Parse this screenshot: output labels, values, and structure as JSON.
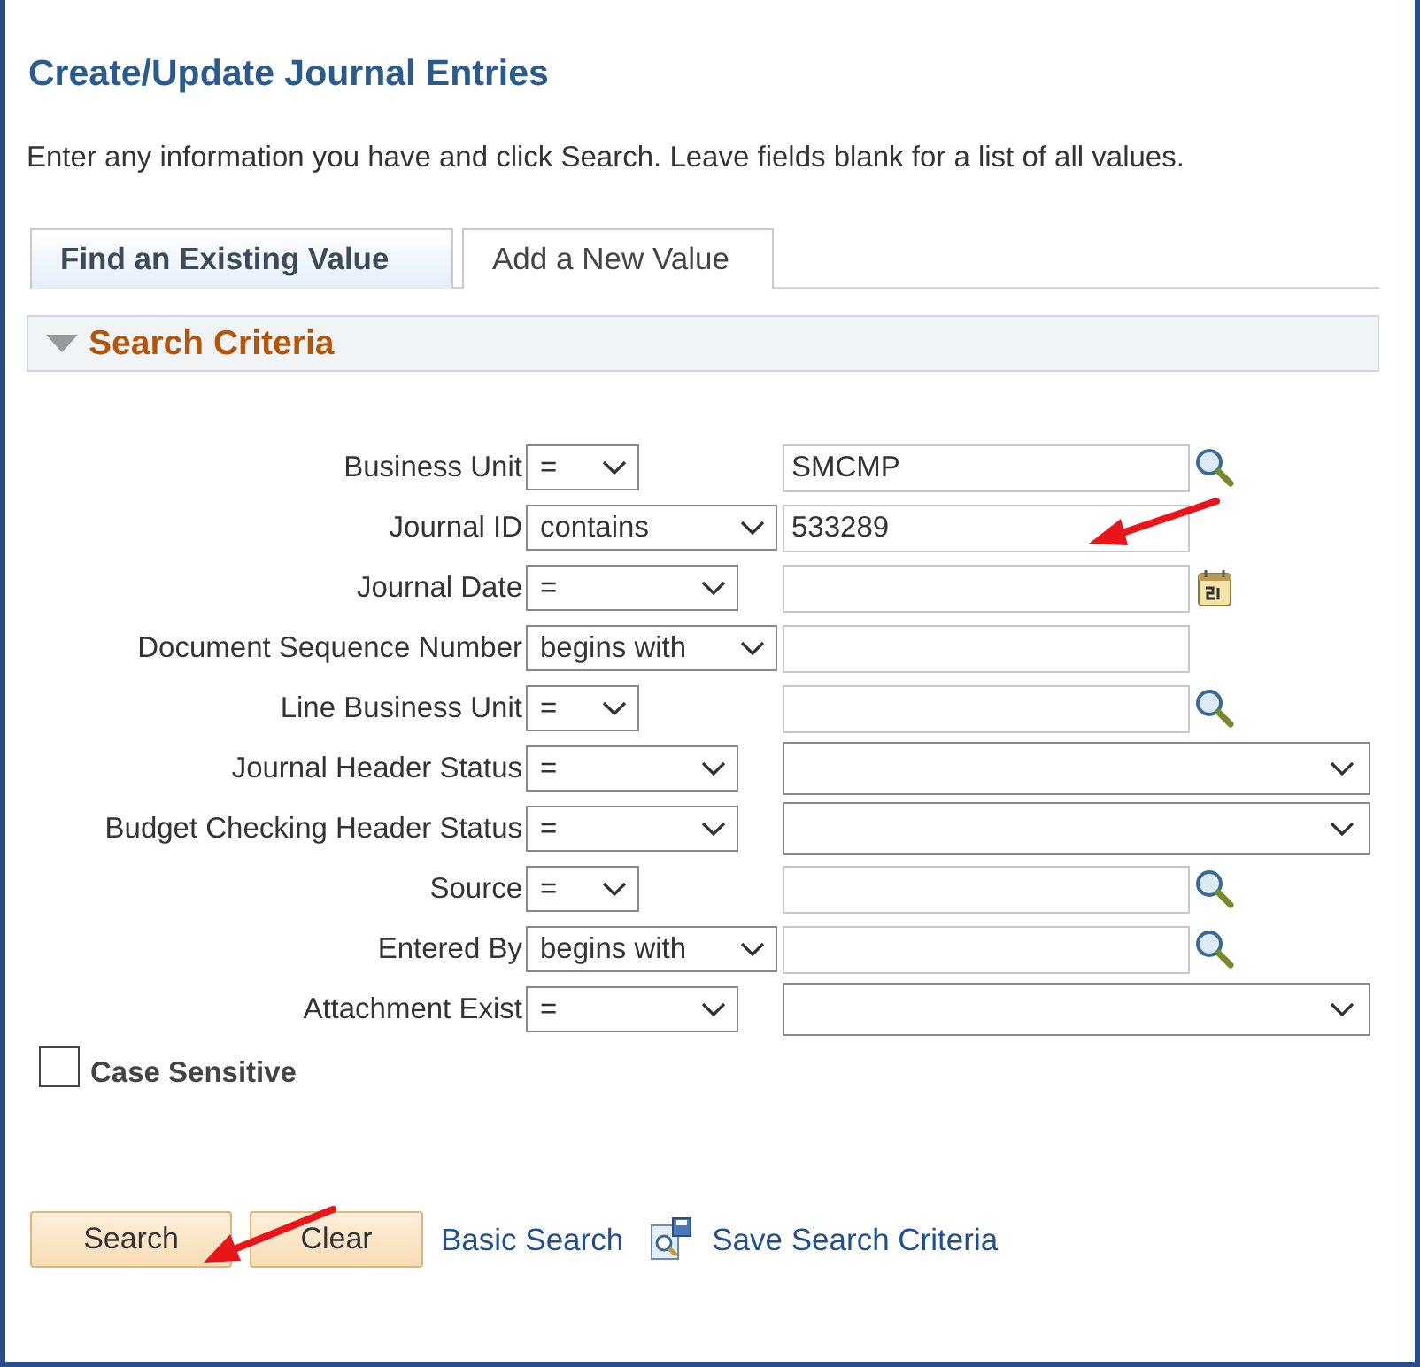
{
  "page": {
    "title": "Create/Update Journal Entries",
    "instructions": "Enter any information you have and click Search. Leave fields blank for a list of all values."
  },
  "tabs": [
    {
      "label": "Find an Existing Value",
      "selected": true
    },
    {
      "label": "Add a New Value",
      "selected": false
    }
  ],
  "section": {
    "title": "Search Criteria",
    "expanded": true
  },
  "fields": [
    {
      "label": "Business Unit",
      "operator": "=",
      "kind": "lookup",
      "value": "SMCMP"
    },
    {
      "label": "Journal ID",
      "operator": "contains",
      "kind": "text",
      "value": "533289"
    },
    {
      "label": "Journal Date",
      "operator": "=",
      "kind": "calendar"
    },
    {
      "label": "Document Sequence Number",
      "operator": "begins with",
      "kind": "text"
    },
    {
      "label": "Line Business Unit",
      "operator": "=",
      "kind": "lookup"
    },
    {
      "label": "Journal Header Status",
      "operator": "=",
      "kind": "dropdown"
    },
    {
      "label": "Budget Checking Header Status",
      "operator": "=",
      "kind": "dropdown"
    },
    {
      "label": "Source",
      "operator": "=",
      "kind": "lookup"
    },
    {
      "label": "Entered By",
      "operator": "begins with",
      "kind": "lookup"
    },
    {
      "label": "Attachment Exist",
      "operator": "=",
      "kind": "dropdown"
    }
  ],
  "case_sensitive": {
    "label": "Case Sensitive",
    "checked": false
  },
  "buttons": [
    "Search",
    "Clear"
  ],
  "links": [
    {
      "label": "Basic Search",
      "kind": "plain"
    },
    {
      "label": "Save Search Criteria",
      "kind": "icon"
    }
  ]
}
